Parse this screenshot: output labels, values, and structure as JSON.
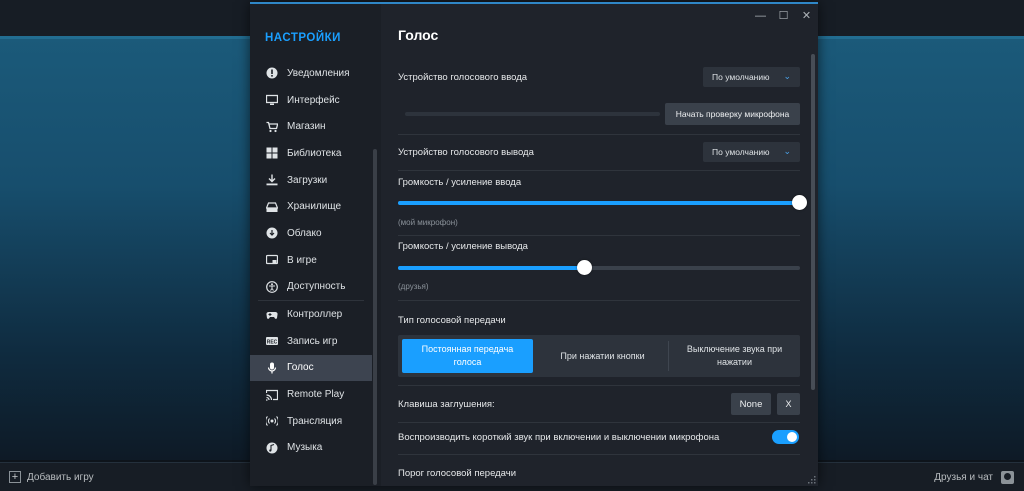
{
  "background": {
    "bottom_bar": {
      "add_game_label": "Добавить игру",
      "friends_label": "Друзья и чат"
    }
  },
  "window": {
    "controls": {
      "minimize": "—",
      "maximize": "☐",
      "close": "✕"
    }
  },
  "sidebar": {
    "title": "НАСТРОЙКИ",
    "items": [
      {
        "label": "Уведомления",
        "icon": "alert-icon"
      },
      {
        "label": "Интерфейс",
        "icon": "monitor-icon"
      },
      {
        "label": "Магазин",
        "icon": "cart-icon"
      },
      {
        "label": "Библиотека",
        "icon": "grid-icon"
      },
      {
        "label": "Загрузки",
        "icon": "download-icon"
      },
      {
        "label": "Хранилище",
        "icon": "drive-icon"
      },
      {
        "label": "Облако",
        "icon": "cloud-icon"
      },
      {
        "label": "В игре",
        "icon": "ingame-icon"
      },
      {
        "label": "Доступность",
        "icon": "accessibility-icon"
      },
      {
        "label": "Контроллер",
        "icon": "gamepad-icon"
      },
      {
        "label": "Запись игр",
        "icon": "rec-icon"
      },
      {
        "label": "Голос",
        "icon": "mic-icon",
        "active": true
      },
      {
        "label": "Remote Play",
        "icon": "cast-icon"
      },
      {
        "label": "Трансляция",
        "icon": "broadcast-icon"
      },
      {
        "label": "Музыка",
        "icon": "music-icon"
      }
    ]
  },
  "voice": {
    "title": "Голос",
    "input_device_label": "Устройство голосового ввода",
    "input_device_value": "По умолчанию",
    "test_mic_button": "Начать проверку микрофона",
    "output_device_label": "Устройство голосового вывода",
    "output_device_value": "По умолчанию",
    "input_volume_label": "Громкость / усиление ввода",
    "input_volume_hint": "(мой микрофон)",
    "input_volume_level": 1.0,
    "output_volume_label": "Громкость / усиление вывода",
    "output_volume_hint": "(друзья)",
    "output_volume_level": 0.465,
    "transmission_type_label": "Тип голосовой передачи",
    "transmission_options": [
      "Постоянная передача голоса",
      "При нажатии кнопки",
      "Выключение звука при нажатии"
    ],
    "transmission_selected": 0,
    "mute_key_label": "Клавиша заглушения:",
    "mute_key_value": "None",
    "mute_key_clear": "X",
    "play_sound_label": "Воспроизводить короткий звук при включении и выключении микрофона",
    "play_sound_enabled": true,
    "threshold_label": "Порог голосовой передачи"
  },
  "colors": {
    "accent": "#1a9fff",
    "window_bg": "#1f232b",
    "sidebar_bg": "#1b1f26"
  }
}
